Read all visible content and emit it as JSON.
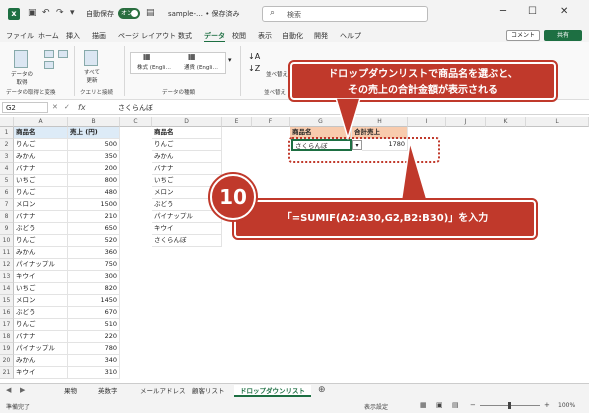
{
  "titlebar": {
    "autosave_label": "自動保存",
    "toggle_label": "オン",
    "filename": "sample-… • 保存済み",
    "search_placeholder": "検索"
  },
  "menu": {
    "items": [
      "ファイル",
      "ホーム",
      "挿入",
      "描画",
      "ページ レイアウト",
      "数式",
      "データ",
      "校閲",
      "表示",
      "自動化",
      "開発",
      "ヘルプ"
    ],
    "active_index": 6,
    "comment_label": "コメント",
    "share_label": "共有"
  },
  "ribbon": {
    "get_data_label": "データの\n取得",
    "group1": "データの取得と変換",
    "refresh_label": "すべて\n更新",
    "group2": "クエリと接続",
    "stocks_label": "株式 (Engli…",
    "currency_label": "通貨 (Engli…",
    "group3": "データの種類",
    "sort_label": "並べ替え",
    "group4": "並べ替え"
  },
  "formula_bar": {
    "cell_ref": "G2",
    "fx": "fx",
    "content": "さくらんぼ"
  },
  "grid": {
    "columns": [
      "A",
      "B",
      "C",
      "D",
      "E",
      "F",
      "G",
      "H",
      "I",
      "J",
      "K",
      "L"
    ],
    "header_A": "商品名",
    "header_B": "売上 (円)",
    "header_D": "商品名",
    "header_G": "商品名",
    "header_H": "合計売上",
    "G2": "さくらんぼ",
    "H2": "1780",
    "rows": [
      {
        "r": "1"
      },
      {
        "r": "2",
        "A": "りんご",
        "B": "500",
        "D": "りんご"
      },
      {
        "r": "3",
        "A": "みかん",
        "B": "350",
        "D": "みかん"
      },
      {
        "r": "4",
        "A": "バナナ",
        "B": "200",
        "D": "バナナ"
      },
      {
        "r": "5",
        "A": "いちご",
        "B": "800",
        "D": "いちご"
      },
      {
        "r": "6",
        "A": "りんご",
        "B": "480",
        "D": "メロン"
      },
      {
        "r": "7",
        "A": "メロン",
        "B": "1500",
        "D": "ぶどう"
      },
      {
        "r": "8",
        "A": "バナナ",
        "B": "210",
        "D": "パイナップル"
      },
      {
        "r": "9",
        "A": "ぶどう",
        "B": "650",
        "D": "キウイ"
      },
      {
        "r": "10",
        "A": "りんご",
        "B": "520",
        "D": "さくらんぼ"
      },
      {
        "r": "11",
        "A": "みかん",
        "B": "360"
      },
      {
        "r": "12",
        "A": "パイナップル",
        "B": "750"
      },
      {
        "r": "13",
        "A": "キウイ",
        "B": "300"
      },
      {
        "r": "14",
        "A": "いちご",
        "B": "820"
      },
      {
        "r": "15",
        "A": "メロン",
        "B": "1450"
      },
      {
        "r": "16",
        "A": "ぶどう",
        "B": "670"
      },
      {
        "r": "17",
        "A": "りんご",
        "B": "510"
      },
      {
        "r": "18",
        "A": "バナナ",
        "B": "220"
      },
      {
        "r": "19",
        "A": "パイナップル",
        "B": "780"
      },
      {
        "r": "20",
        "A": "みかん",
        "B": "340"
      },
      {
        "r": "21",
        "A": "キウイ",
        "B": "310"
      }
    ]
  },
  "tabs": {
    "items": [
      "果物",
      "英数字",
      "メールアドレス",
      "顧客リスト",
      "ドロップダウンリスト"
    ],
    "active_index": 4
  },
  "status": {
    "ready": "準備完了",
    "display_settings": "表示設定",
    "zoom": "100%"
  },
  "callouts": {
    "top": "ドロップダウンリストで商品名を選ぶと、\nその売上の合計金額が表示される",
    "step_number": "10",
    "bottom": "「=SUMIF(A2:A30,G2,B2:B30)」を入力"
  },
  "colors": {
    "excel_green": "#1d6f42",
    "callout_red": "#c0392b",
    "header_blue": "#ddebf7",
    "header_orange": "#f8cbad"
  }
}
